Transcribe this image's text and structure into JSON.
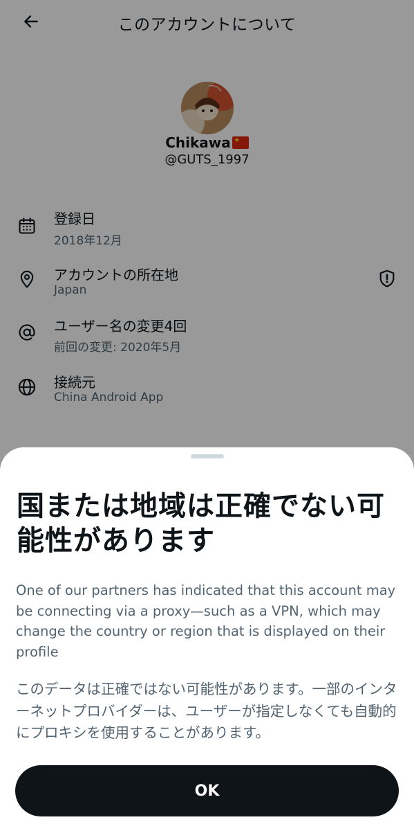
{
  "header": {
    "title": "このアカウントについて",
    "back_icon": "arrow-left-icon"
  },
  "profile": {
    "display_name": "Chikawa",
    "flag_icon": "china-flag-emoji",
    "handle": "@GUTS_1997"
  },
  "info": [
    {
      "icon": "calendar-icon",
      "label": "登録日",
      "value": "2018年12月"
    },
    {
      "icon": "location-pin-icon",
      "label": "アカウントの所在地",
      "value": "Japan",
      "trailing_icon": "shield-alert-icon"
    },
    {
      "icon": "at-sign-icon",
      "label": "ユーザー名の変更4回",
      "value": "前回の変更: 2020年5月"
    },
    {
      "icon": "globe-icon",
      "label": "接続元",
      "value": "China Android App"
    }
  ],
  "sheet": {
    "title": "国または地域は正確でない可能性があります",
    "body_en": "One of our partners has indicated that this account may be connecting via a proxy—such as a VPN, which may change the country or region that is displayed on their profile",
    "body_ja": "このデータは正確ではない可能性があります。一部のインターネットプロバイダーは、ユーザーが指定しなくても自動的にプロキシを使用することがあります。",
    "ok_label": "OK"
  },
  "colors": {
    "text_primary": "#0f1419",
    "text_secondary": "#536471",
    "button_bg": "#0f1419",
    "scrim": "rgba(0,0,0,0.40)"
  }
}
